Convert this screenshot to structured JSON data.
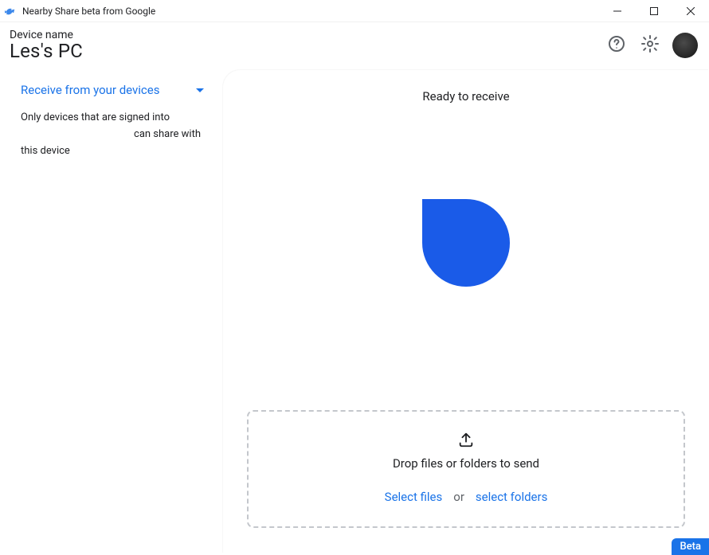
{
  "window": {
    "title": "Nearby Share beta from Google"
  },
  "header": {
    "device_label": "Device name",
    "device_name": "Les's PC"
  },
  "sidebar": {
    "receive_mode_label": "Receive from your devices",
    "description_line1": "Only devices that are signed into",
    "description_line2": "can share with",
    "description_line3": "this device"
  },
  "main": {
    "ready_text": "Ready to receive",
    "drop_text": "Drop files or folders to send",
    "select_files": "Select files",
    "or": "or",
    "select_folders": "select folders"
  },
  "badge": {
    "label": "Beta"
  }
}
